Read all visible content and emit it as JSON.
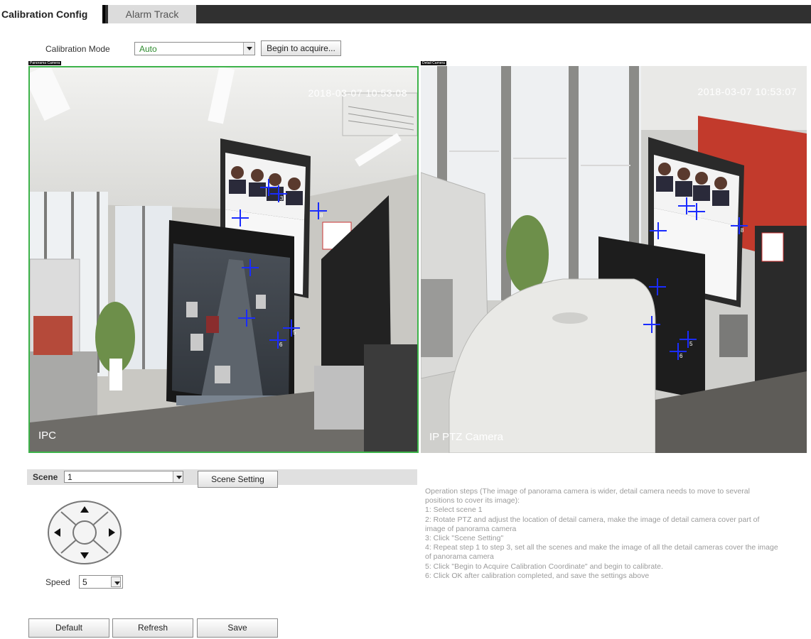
{
  "tabs": [
    {
      "label": "Calibration Config",
      "active": true
    },
    {
      "label": "Alarm Track",
      "active": false
    }
  ],
  "calibration": {
    "mode_label": "Calibration Mode",
    "mode_value": "Auto",
    "acquire_button": "Begin to acquire..."
  },
  "cameras": {
    "left": {
      "caption": "Panorama Camera",
      "timestamp": "2018-03-07 10:53:08",
      "name": "IPC",
      "markers": [
        "2",
        "3",
        "8",
        "5",
        "6"
      ]
    },
    "right": {
      "caption": "Detail Camera",
      "timestamp": "2018-03-07 10:53:07",
      "name": "IP PTZ Camera",
      "markers": [
        "2",
        "4",
        "8",
        "5",
        "6"
      ]
    }
  },
  "scene": {
    "label": "Scene",
    "value": "1",
    "setting_button": "Scene Setting"
  },
  "ptz": {
    "speed_label": "Speed",
    "speed_value": "5"
  },
  "operation_steps": {
    "intro": "Operation steps (The image of panorama camera is wider, detail camera needs to move to several positions to cover its image):",
    "steps": [
      "1: Select scene 1",
      "2: Rotate PTZ and adjust the location of detail camera, make the image of detail camera cover part of image of panorama camera",
      "3: Click \"Scene Setting\"",
      "4: Repeat step 1 to step 3, set all the scenes and make the image of all the detail cameras cover the image of panorama camera",
      "5: Click \"Begin to Acquire Calibration Coordinate\" and begin to calibrate.",
      "6: Click OK after calibration completed, and save the settings above"
    ]
  },
  "buttons": {
    "default": "Default",
    "refresh": "Refresh",
    "save": "Save"
  },
  "colors": {
    "tab_bar": "#303030",
    "selection_border": "#3db34a",
    "marker": "#1a2cff",
    "mode_value_text": "#2e8b2e"
  }
}
